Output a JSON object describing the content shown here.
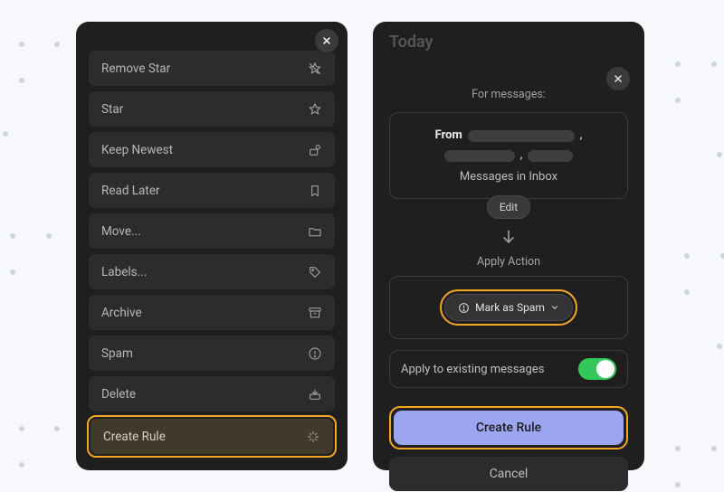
{
  "left_menu": {
    "items": [
      {
        "label": "Remove Star",
        "icon": "star-off-icon"
      },
      {
        "label": "Star",
        "icon": "star-icon"
      },
      {
        "label": "Keep Newest",
        "icon": "keep-newest-icon"
      },
      {
        "label": "Read Later",
        "icon": "bookmark-icon"
      },
      {
        "label": "Move...",
        "icon": "folder-icon"
      },
      {
        "label": "Labels...",
        "icon": "tag-icon"
      },
      {
        "label": "Archive",
        "icon": "archive-icon"
      },
      {
        "label": "Spam",
        "icon": "info-icon"
      },
      {
        "label": "Delete",
        "icon": "delete-tray-icon"
      },
      {
        "label": "Create Rule",
        "icon": "create-rule-icon",
        "highlighted": true
      }
    ]
  },
  "right_panel": {
    "background_title": "Today",
    "for_messages": "For messages:",
    "from_label": "From",
    "messages_in": "Messages in Inbox",
    "edit_label": "Edit",
    "apply_action_label": "Apply Action",
    "selected_action": "Mark as Spam",
    "apply_existing_label": "Apply to existing messages",
    "apply_existing_on": true,
    "primary_button": "Create Rule",
    "secondary_button": "Cancel"
  },
  "colors": {
    "accent": "#9CA5F0",
    "highlight": "#F5A623",
    "toggle_on": "#34C759"
  }
}
